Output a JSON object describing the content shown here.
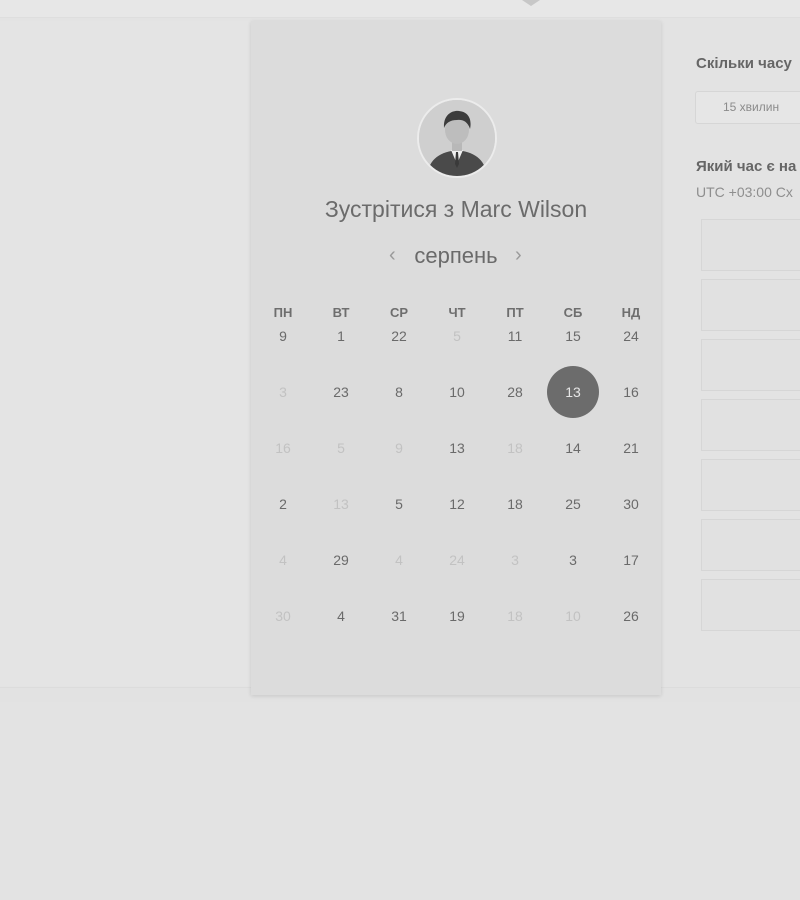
{
  "booking": {
    "title": "Зустрітися з Marc Wilson",
    "month": "серпень"
  },
  "weekdays": [
    "ПН",
    "ВТ",
    "СР",
    "ЧТ",
    "ПТ",
    "СБ",
    "НД"
  ],
  "weeks": [
    [
      {
        "d": "9",
        "on": true
      },
      {
        "d": "1",
        "on": true
      },
      {
        "d": "22",
        "on": true
      },
      {
        "d": "5",
        "on": false
      },
      {
        "d": "11",
        "on": true
      },
      {
        "d": "15",
        "on": true
      },
      {
        "d": "24",
        "on": true
      }
    ],
    [
      {
        "d": "3",
        "on": false
      },
      {
        "d": "23",
        "on": true
      },
      {
        "d": "8",
        "on": true
      },
      {
        "d": "10",
        "on": true
      },
      {
        "d": "28",
        "on": true
      },
      {
        "d": "13",
        "on": true,
        "selected": true
      },
      {
        "d": "16",
        "on": true
      }
    ],
    [
      {
        "d": "16",
        "on": false
      },
      {
        "d": "5",
        "on": false
      },
      {
        "d": "9",
        "on": false
      },
      {
        "d": "13",
        "on": true
      },
      {
        "d": "18",
        "on": false
      },
      {
        "d": "14",
        "on": true
      },
      {
        "d": "21",
        "on": true
      }
    ],
    [
      {
        "d": "2",
        "on": true
      },
      {
        "d": "13",
        "on": false
      },
      {
        "d": "5",
        "on": true
      },
      {
        "d": "12",
        "on": true
      },
      {
        "d": "18",
        "on": true
      },
      {
        "d": "25",
        "on": true
      },
      {
        "d": "30",
        "on": true
      }
    ],
    [
      {
        "d": "4",
        "on": false
      },
      {
        "d": "29",
        "on": true
      },
      {
        "d": "4",
        "on": false
      },
      {
        "d": "24",
        "on": false
      },
      {
        "d": "3",
        "on": false
      },
      {
        "d": "3",
        "on": true
      },
      {
        "d": "17",
        "on": true
      }
    ],
    [
      {
        "d": "30",
        "on": false
      },
      {
        "d": "4",
        "on": true
      },
      {
        "d": "31",
        "on": true
      },
      {
        "d": "19",
        "on": true
      },
      {
        "d": "18",
        "on": false
      },
      {
        "d": "10",
        "on": false
      },
      {
        "d": "26",
        "on": true
      }
    ]
  ],
  "side": {
    "duration_title": "Скільки часу",
    "duration_value": "15 хвилин",
    "time_title": "Який час є на",
    "timezone": "UTC +03:00 Сх"
  },
  "colors": {
    "selected_day": "#6c6c6c"
  }
}
